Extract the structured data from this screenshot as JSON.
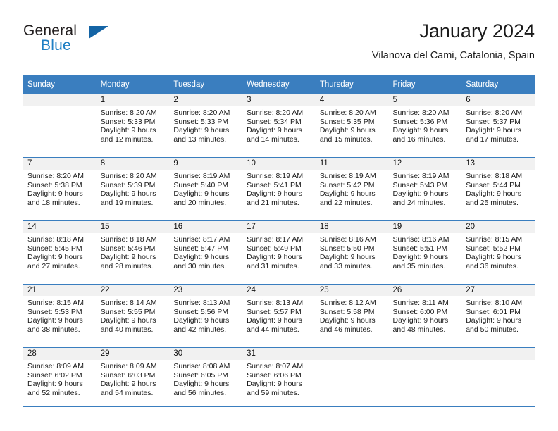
{
  "brand": {
    "name_top": "General",
    "name_bottom": "Blue",
    "triangle_color": "#1464a5",
    "blue_text_color": "#1f7fc4"
  },
  "header": {
    "title": "January 2024",
    "subtitle": "Vilanova del Cami, Catalonia, Spain"
  },
  "theme": {
    "header_bg": "#3a7ebf",
    "header_text": "#ffffff",
    "daynum_band_bg": "#f1f1f1",
    "grid_line": "#3a7ebf"
  },
  "weekdays": [
    "Sunday",
    "Monday",
    "Tuesday",
    "Wednesday",
    "Thursday",
    "Friday",
    "Saturday"
  ],
  "weeks": [
    [
      {
        "day": "",
        "lines": []
      },
      {
        "day": "1",
        "lines": [
          "Sunrise: 8:20 AM",
          "Sunset: 5:33 PM",
          "Daylight: 9 hours",
          "and 12 minutes."
        ]
      },
      {
        "day": "2",
        "lines": [
          "Sunrise: 8:20 AM",
          "Sunset: 5:33 PM",
          "Daylight: 9 hours",
          "and 13 minutes."
        ]
      },
      {
        "day": "3",
        "lines": [
          "Sunrise: 8:20 AM",
          "Sunset: 5:34 PM",
          "Daylight: 9 hours",
          "and 14 minutes."
        ]
      },
      {
        "day": "4",
        "lines": [
          "Sunrise: 8:20 AM",
          "Sunset: 5:35 PM",
          "Daylight: 9 hours",
          "and 15 minutes."
        ]
      },
      {
        "day": "5",
        "lines": [
          "Sunrise: 8:20 AM",
          "Sunset: 5:36 PM",
          "Daylight: 9 hours",
          "and 16 minutes."
        ]
      },
      {
        "day": "6",
        "lines": [
          "Sunrise: 8:20 AM",
          "Sunset: 5:37 PM",
          "Daylight: 9 hours",
          "and 17 minutes."
        ]
      }
    ],
    [
      {
        "day": "7",
        "lines": [
          "Sunrise: 8:20 AM",
          "Sunset: 5:38 PM",
          "Daylight: 9 hours",
          "and 18 minutes."
        ]
      },
      {
        "day": "8",
        "lines": [
          "Sunrise: 8:20 AM",
          "Sunset: 5:39 PM",
          "Daylight: 9 hours",
          "and 19 minutes."
        ]
      },
      {
        "day": "9",
        "lines": [
          "Sunrise: 8:19 AM",
          "Sunset: 5:40 PM",
          "Daylight: 9 hours",
          "and 20 minutes."
        ]
      },
      {
        "day": "10",
        "lines": [
          "Sunrise: 8:19 AM",
          "Sunset: 5:41 PM",
          "Daylight: 9 hours",
          "and 21 minutes."
        ]
      },
      {
        "day": "11",
        "lines": [
          "Sunrise: 8:19 AM",
          "Sunset: 5:42 PM",
          "Daylight: 9 hours",
          "and 22 minutes."
        ]
      },
      {
        "day": "12",
        "lines": [
          "Sunrise: 8:19 AM",
          "Sunset: 5:43 PM",
          "Daylight: 9 hours",
          "and 24 minutes."
        ]
      },
      {
        "day": "13",
        "lines": [
          "Sunrise: 8:18 AM",
          "Sunset: 5:44 PM",
          "Daylight: 9 hours",
          "and 25 minutes."
        ]
      }
    ],
    [
      {
        "day": "14",
        "lines": [
          "Sunrise: 8:18 AM",
          "Sunset: 5:45 PM",
          "Daylight: 9 hours",
          "and 27 minutes."
        ]
      },
      {
        "day": "15",
        "lines": [
          "Sunrise: 8:18 AM",
          "Sunset: 5:46 PM",
          "Daylight: 9 hours",
          "and 28 minutes."
        ]
      },
      {
        "day": "16",
        "lines": [
          "Sunrise: 8:17 AM",
          "Sunset: 5:47 PM",
          "Daylight: 9 hours",
          "and 30 minutes."
        ]
      },
      {
        "day": "17",
        "lines": [
          "Sunrise: 8:17 AM",
          "Sunset: 5:49 PM",
          "Daylight: 9 hours",
          "and 31 minutes."
        ]
      },
      {
        "day": "18",
        "lines": [
          "Sunrise: 8:16 AM",
          "Sunset: 5:50 PM",
          "Daylight: 9 hours",
          "and 33 minutes."
        ]
      },
      {
        "day": "19",
        "lines": [
          "Sunrise: 8:16 AM",
          "Sunset: 5:51 PM",
          "Daylight: 9 hours",
          "and 35 minutes."
        ]
      },
      {
        "day": "20",
        "lines": [
          "Sunrise: 8:15 AM",
          "Sunset: 5:52 PM",
          "Daylight: 9 hours",
          "and 36 minutes."
        ]
      }
    ],
    [
      {
        "day": "21",
        "lines": [
          "Sunrise: 8:15 AM",
          "Sunset: 5:53 PM",
          "Daylight: 9 hours",
          "and 38 minutes."
        ]
      },
      {
        "day": "22",
        "lines": [
          "Sunrise: 8:14 AM",
          "Sunset: 5:55 PM",
          "Daylight: 9 hours",
          "and 40 minutes."
        ]
      },
      {
        "day": "23",
        "lines": [
          "Sunrise: 8:13 AM",
          "Sunset: 5:56 PM",
          "Daylight: 9 hours",
          "and 42 minutes."
        ]
      },
      {
        "day": "24",
        "lines": [
          "Sunrise: 8:13 AM",
          "Sunset: 5:57 PM",
          "Daylight: 9 hours",
          "and 44 minutes."
        ]
      },
      {
        "day": "25",
        "lines": [
          "Sunrise: 8:12 AM",
          "Sunset: 5:58 PM",
          "Daylight: 9 hours",
          "and 46 minutes."
        ]
      },
      {
        "day": "26",
        "lines": [
          "Sunrise: 8:11 AM",
          "Sunset: 6:00 PM",
          "Daylight: 9 hours",
          "and 48 minutes."
        ]
      },
      {
        "day": "27",
        "lines": [
          "Sunrise: 8:10 AM",
          "Sunset: 6:01 PM",
          "Daylight: 9 hours",
          "and 50 minutes."
        ]
      }
    ],
    [
      {
        "day": "28",
        "lines": [
          "Sunrise: 8:09 AM",
          "Sunset: 6:02 PM",
          "Daylight: 9 hours",
          "and 52 minutes."
        ]
      },
      {
        "day": "29",
        "lines": [
          "Sunrise: 8:09 AM",
          "Sunset: 6:03 PM",
          "Daylight: 9 hours",
          "and 54 minutes."
        ]
      },
      {
        "day": "30",
        "lines": [
          "Sunrise: 8:08 AM",
          "Sunset: 6:05 PM",
          "Daylight: 9 hours",
          "and 56 minutes."
        ]
      },
      {
        "day": "31",
        "lines": [
          "Sunrise: 8:07 AM",
          "Sunset: 6:06 PM",
          "Daylight: 9 hours",
          "and 59 minutes."
        ]
      },
      {
        "day": "",
        "lines": []
      },
      {
        "day": "",
        "lines": []
      },
      {
        "day": "",
        "lines": []
      }
    ]
  ]
}
